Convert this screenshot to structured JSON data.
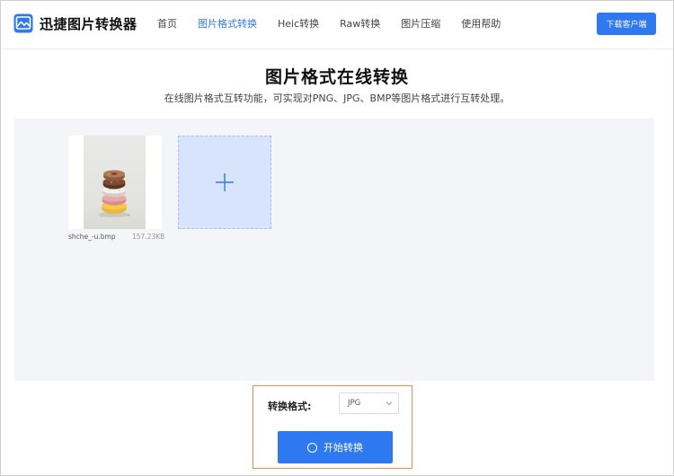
{
  "header": {
    "logo_text": "迅捷图片转换器",
    "nav": [
      {
        "label": "首页",
        "active": false
      },
      {
        "label": "图片格式转换",
        "active": true
      },
      {
        "label": "Heic转换",
        "active": false
      },
      {
        "label": "Raw转换",
        "active": false
      },
      {
        "label": "图片压缩",
        "active": false
      },
      {
        "label": "使用帮助",
        "active": false
      }
    ],
    "download_label": "下载客户端"
  },
  "main": {
    "title": "图片格式在线转换",
    "subtitle": "在线图片格式互转功能，可实现对PNG、JPG、BMP等图片格式进行互转处理。"
  },
  "upload": {
    "file": {
      "name": "shche_-u.bmp",
      "size": "157.23KB"
    }
  },
  "convert": {
    "format_label": "转换格式:",
    "format_value": "JPG",
    "start_label": "开始转换"
  },
  "colors": {
    "accent": "#2f79f0",
    "highlight_border": "#ef8c4d",
    "panel_bg": "#f3f5f9",
    "add_tile_bg": "#d8e4fb"
  },
  "icons": {
    "logo": "image-logo-icon",
    "add": "plus-icon",
    "select": "chevron-down-icon",
    "start": "circle-icon"
  }
}
